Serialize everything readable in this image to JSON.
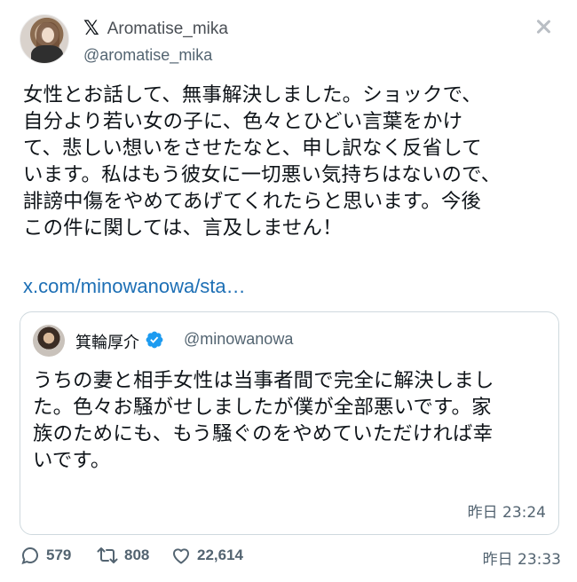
{
  "author": {
    "display_name": "Aromatise_mika",
    "handle": "@aromatise_mika",
    "platform_logo": "𝕏"
  },
  "tweet": {
    "text": "女性とお話して、無事解決しました。ショックで、\n自分より若い女の子に、色々とひどい言葉をかけ\nて、悲しい想いをさせたなと、申し訳なく反省して\nいます。私はもう彼女に一切悪い気持ちはないので、\n誹謗中傷をやめてあげてくれたらと思います。今後\nこの件に関しては、言及しません！",
    "link": "x.com/minowanowa/sta…",
    "timestamp": "昨日 23:33"
  },
  "quote": {
    "display_name": "箕輪厚介",
    "handle": "@minowanowa",
    "verified": true,
    "text": "うちの妻と相手女性は当事者間で完全に解決しまし\nた。色々お騒がせしましたが僕が全部悪いです。家\n族のためにも、もう騒ぐのをやめていただければ幸\nいです。",
    "timestamp": "昨日 23:24"
  },
  "actions": {
    "replies": "579",
    "retweets": "808",
    "likes": "22,614"
  },
  "colors": {
    "link": "#1d6fb5",
    "verified": "#1d9bf0",
    "muted": "#536471",
    "border": "#cfd9de"
  }
}
